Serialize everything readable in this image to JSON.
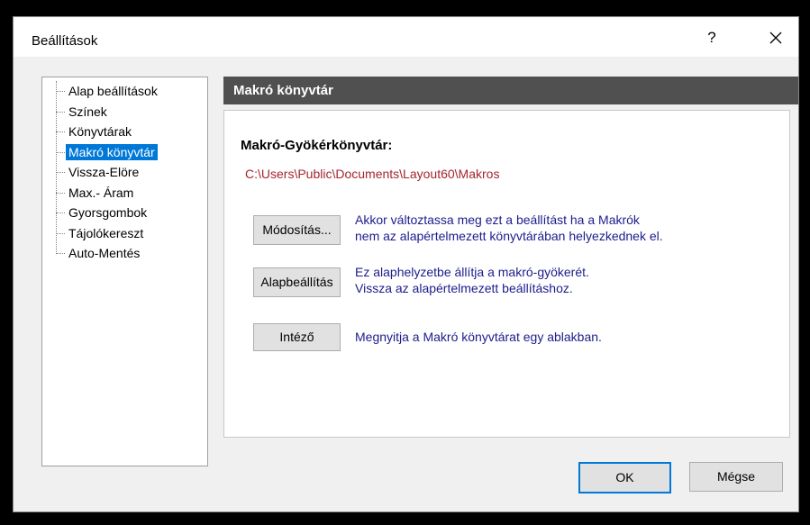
{
  "window": {
    "title": "Beállítások",
    "help_label": "?"
  },
  "tree": {
    "items": [
      {
        "label": "Alap beállítások",
        "selected": false
      },
      {
        "label": "Színek",
        "selected": false
      },
      {
        "label": "Könyvtárak",
        "selected": false
      },
      {
        "label": "Makró könyvtár",
        "selected": true
      },
      {
        "label": "Vissza-Elöre",
        "selected": false
      },
      {
        "label": "Max.- Áram",
        "selected": false
      },
      {
        "label": "Gyorsgombok",
        "selected": false
      },
      {
        "label": "Tájolókereszt",
        "selected": false
      },
      {
        "label": "Auto-Mentés",
        "selected": false
      }
    ]
  },
  "panel": {
    "header": "Makró könyvtár",
    "root_label": "Makró-Gyökérkönyvtár:",
    "root_path": "C:\\Users\\Public\\Documents\\Layout60\\Makros",
    "modify_button": "Módosítás...",
    "modify_desc_1": "Akkor változtassa meg ezt a beállítást ha a Makrók",
    "modify_desc_2": "nem az alapértelmezett könyvtárában helyezkednek el.",
    "default_button": "Alapbeállítás",
    "default_desc_1": "Ez alaphelyzetbe állítja a makró-gyökerét.",
    "default_desc_2": "Vissza az alapértelmezett beállításhoz.",
    "explorer_button": "Intéző",
    "explorer_desc": "Megnyitja a Makró könyvtárat egy ablakban."
  },
  "footer": {
    "ok_label": "OK",
    "cancel_label": "Mégse"
  },
  "colors": {
    "accent": "#0078d7",
    "path": "#a4262c",
    "desc": "#1c1c8c",
    "header_bg": "#505050"
  }
}
